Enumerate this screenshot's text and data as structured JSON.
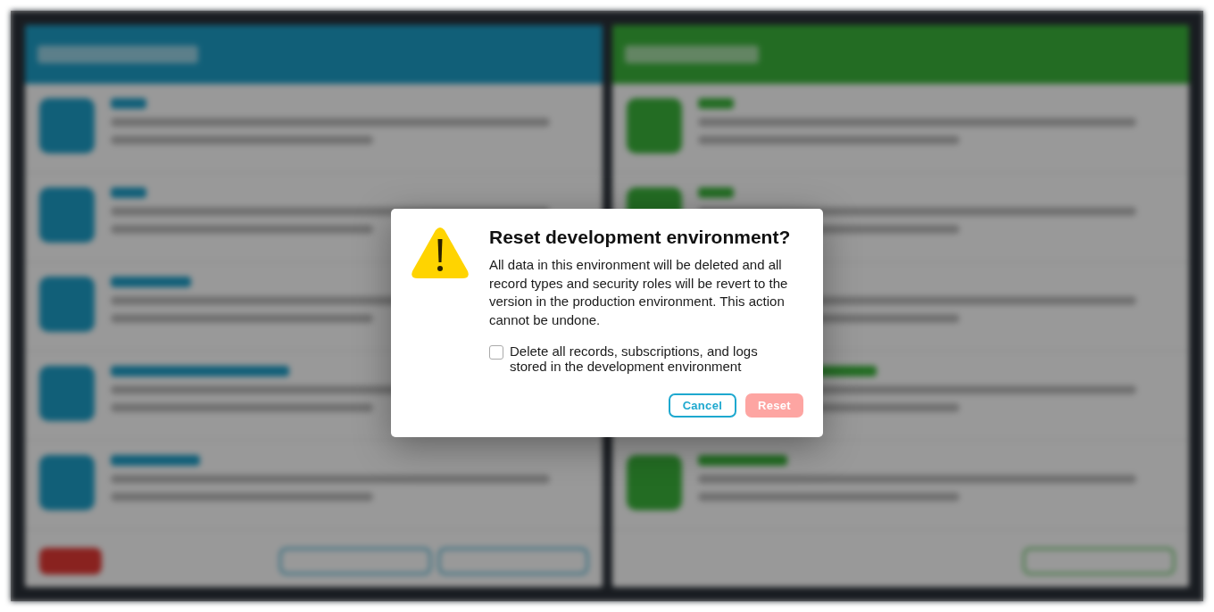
{
  "dialog": {
    "title": "Reset development environment?",
    "message": "All data in this environment will be deleted and all record types and security roles will be revert to the version in the production environment. This action cannot be undone.",
    "checkbox": {
      "label": "Delete all records, subscriptions, and logs stored in the development environment",
      "checked": false
    },
    "buttons": [
      {
        "label": "Cancel",
        "kind": "secondary",
        "disabled": false
      },
      {
        "label": "Reset",
        "kind": "destructive",
        "disabled": true
      }
    ]
  }
}
